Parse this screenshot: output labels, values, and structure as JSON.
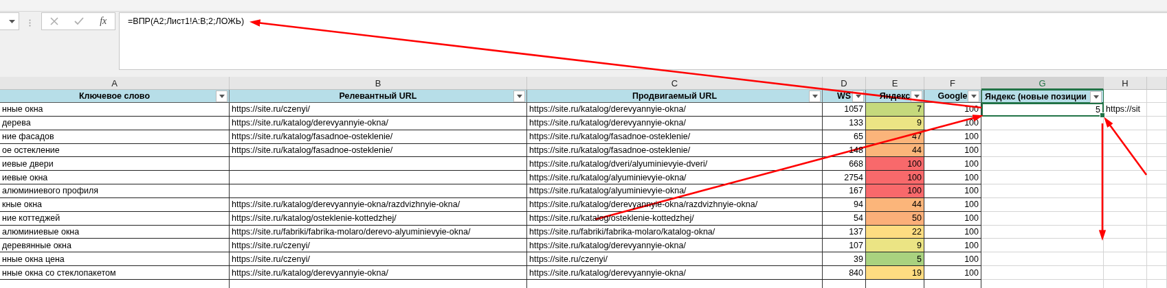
{
  "formula_bar": {
    "function_label": "fx",
    "formula": "=ВПР(A2;Лист1!A:B;2;ЛОЖЬ)"
  },
  "column_letters": [
    {
      "label": "A",
      "selected": false
    },
    {
      "label": "B",
      "selected": false
    },
    {
      "label": "C",
      "selected": false
    },
    {
      "label": "D",
      "selected": false
    },
    {
      "label": "E",
      "selected": false
    },
    {
      "label": "F",
      "selected": false
    },
    {
      "label": "G",
      "selected": true
    },
    {
      "label": "H",
      "selected": false
    }
  ],
  "table": {
    "columns": [
      "Ключевое слово",
      "Релевантный URL",
      "Продвигаемый URL",
      "WS",
      "Яндекс",
      "Google",
      "Яндекс (новые позиции"
    ],
    "rows": [
      {
        "keyword": "нные окна",
        "relevant_url": "https://site.ru/czenyi/",
        "promoted_url": "https://site.ru/katalog/derevyannyie-okna/",
        "ws": "1057",
        "yandex": {
          "value": "7",
          "color": "#c5d97c"
        },
        "google": "100",
        "yandex_new": "5",
        "column_h": "https://sit",
        "selected": true
      },
      {
        "keyword": "дерева",
        "relevant_url": "https://site.ru/katalog/derevyannyie-okna/",
        "promoted_url": "https://site.ru/katalog/derevyannyie-okna/",
        "ws": "133",
        "yandex": {
          "value": "9",
          "color": "#ebe484"
        },
        "google": "100",
        "selected": false
      },
      {
        "keyword": "ние фасадов",
        "relevant_url": "https://site.ru/katalog/fasadnoe-osteklenie/",
        "promoted_url": "https://site.ru/katalog/fasadnoe-osteklenie/",
        "ws": "65",
        "yandex": {
          "value": "47",
          "color": "#fbb47a"
        },
        "google": "100",
        "selected": false
      },
      {
        "keyword": "ое остекление",
        "relevant_url": "https://site.ru/katalog/fasadnoe-osteklenie/",
        "promoted_url": "https://site.ru/katalog/fasadnoe-osteklenie/",
        "ws": "148",
        "yandex": {
          "value": "44",
          "color": "#fbb57a"
        },
        "google": "100",
        "selected": false
      },
      {
        "keyword": "иевые двери",
        "promoted_url": "https://site.ru/katalog/dveri/alyuminievyie-dveri/",
        "ws": "668",
        "yandex": {
          "value": "100",
          "color": "#f8696b"
        },
        "google": "100",
        "selected": false
      },
      {
        "keyword": "иевые окна",
        "promoted_url": "https://site.ru/katalog/alyuminievyie-okna/",
        "ws": "2754",
        "yandex": {
          "value": "100",
          "color": "#f8696b"
        },
        "google": "100",
        "selected": false
      },
      {
        "keyword": "алюминиевого профиля",
        "promoted_url": "https://site.ru/katalog/alyuminievyie-okna/",
        "ws": "167",
        "yandex": {
          "value": "100",
          "color": "#f8696b"
        },
        "google": "100",
        "selected": false
      },
      {
        "keyword": "кные окна",
        "relevant_url": "https://site.ru/katalog/derevyannyie-okna/razdvizhnyie-okna/",
        "promoted_url": "https://site.ru/katalog/derevyannyie-okna/razdvizhnyie-okna/",
        "ws": "94",
        "yandex": {
          "value": "44",
          "color": "#fbb57a"
        },
        "google": "100",
        "selected": false
      },
      {
        "keyword": "ние коттеджей",
        "relevant_url": "https://site.ru/katalog/osteklenie-kottedzhej/",
        "promoted_url": "https://site.ru/katalog/osteklenie-kottedzhej/",
        "ws": "54",
        "yandex": {
          "value": "50",
          "color": "#fbaf79"
        },
        "google": "100",
        "selected": false
      },
      {
        "keyword": "алюминиевые окна",
        "relevant_url": "https://site.ru/fabriki/fabrika-molaro/derevo-alyuminievyie-okna/",
        "promoted_url": "https://site.ru/fabriki/fabrika-molaro/katalog-okna/",
        "ws": "137",
        "yandex": {
          "value": "22",
          "color": "#fedd81"
        },
        "google": "100",
        "selected": false
      },
      {
        "keyword": "деревянные окна",
        "relevant_url": "https://site.ru/czenyi/",
        "promoted_url": "https://site.ru/katalog/derevyannyie-okna/",
        "ws": "107",
        "yandex": {
          "value": "9",
          "color": "#ebe484"
        },
        "google": "100",
        "selected": false
      },
      {
        "keyword": "нные окна цена",
        "relevant_url": "https://site.ru/czenyi/",
        "promoted_url": "https://site.ru/czenyi/",
        "ws": "39",
        "yandex": {
          "value": "5",
          "color": "#a9d27f"
        },
        "google": "100",
        "selected": false
      },
      {
        "keyword": "нные окна со стеклопакетом",
        "relevant_url": "https://site.ru/katalog/derevyannyie-okna/",
        "promoted_url": "https://site.ru/katalog/derevyannyie-okna/",
        "ws": "840",
        "yandex": {
          "value": "19",
          "color": "#fedc81"
        },
        "google": "100",
        "selected": false
      }
    ]
  }
}
